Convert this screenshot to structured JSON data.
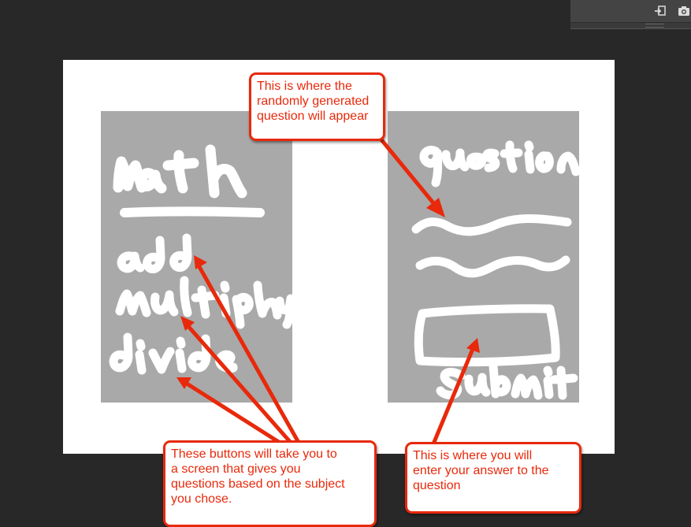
{
  "toolbar": {
    "icons": [
      "import-icon",
      "camera-icon"
    ]
  },
  "colors": {
    "background": "#282828",
    "canvas": "#ffffff",
    "panel_fill": "#a9a9a9",
    "handwriting": "#ffffff",
    "callout_accent": "#e8290b"
  },
  "sketch": {
    "left_panel": {
      "title": "math",
      "buttons": [
        "add",
        "multiply",
        "divide"
      ]
    },
    "right_panel": {
      "title": "question",
      "action": "submit"
    }
  },
  "callouts": {
    "question": "This is where the\nrandomly generated\nquestion will appear",
    "buttons": "These buttons will take you to\na screen that gives you\nquestions based on the subject\nyou chose.",
    "answer": "This is where you will\nenter your answer to the\nquestion"
  }
}
